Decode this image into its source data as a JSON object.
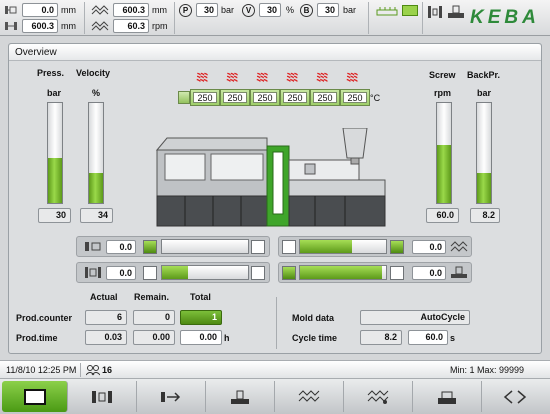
{
  "topbar": {
    "mold_pos": "0.0",
    "mold_pos_unit": "mm",
    "mold_stroke": "600.3",
    "mold_stroke_unit": "mm",
    "screw_pos": "600.3",
    "screw_pos_unit": "mm",
    "screw_speed": "60.3",
    "screw_speed_unit": "rpm",
    "pressure_p": "30",
    "pressure_p_unit": "bar",
    "velocity_v": "30",
    "velocity_v_unit": "%",
    "pressure_b": "30",
    "pressure_b_unit": "bar",
    "logo": "KEBA"
  },
  "overview": {
    "title": "Overview",
    "left_bars": [
      {
        "label": "Press.",
        "unit": "bar",
        "value": "30",
        "fill": 0.45
      },
      {
        "label": "Velocity",
        "unit": "%",
        "value": "34",
        "fill": 0.3
      }
    ],
    "right_bars": [
      {
        "label": "Screw",
        "unit": "rpm",
        "value": "60.0",
        "fill": 0.58
      },
      {
        "label": "BackPr.",
        "unit": "bar",
        "value": "8.2",
        "fill": 0.3
      }
    ],
    "heater_zones": [
      "250",
      "250",
      "250",
      "250",
      "250",
      "250"
    ],
    "heater_unit": "°C",
    "controls": {
      "mold": {
        "value": "0.0",
        "fill": 0.0
      },
      "injection": {
        "value": "0.0",
        "fill": 0.6
      },
      "ejector": {
        "value": "0.0",
        "fill": 0.3
      },
      "nozzle": {
        "value": "0.0",
        "fill": 0.95
      }
    },
    "production": {
      "col_actual": "Actual",
      "col_remain": "Remain.",
      "col_total": "Total",
      "counter_label": "Prod.counter",
      "counter_actual": "6",
      "counter_remain": "0",
      "counter_total": "1",
      "time_label": "Prod.time",
      "time_actual": "0.03",
      "time_remain": "0.00",
      "time_total": "0.00",
      "time_unit": "h"
    },
    "mold_data_label": "Mold data",
    "mold_data_value": "AutoCycle",
    "cycle_time_label": "Cycle time",
    "cycle_time_actual": "8.2",
    "cycle_time_set": "60.0",
    "cycle_time_unit": "s"
  },
  "statusbar": {
    "datetime": "11/8/10  12:25 PM",
    "user_count": "16",
    "min_max": "Min: 1  Max: 99999"
  },
  "colors": {
    "accent_green": "#5aa61e",
    "heater_red": "#dd2222",
    "logo_green": "#2e8a3a"
  }
}
